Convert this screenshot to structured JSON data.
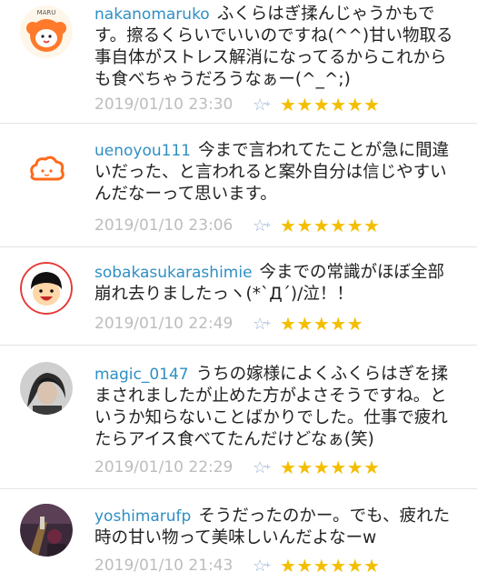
{
  "colors": {
    "username": "#2f8fc4",
    "star": "#f4be00",
    "date": "#bdbdbd"
  },
  "comments": [
    {
      "user": "nakanomaruko",
      "body": "ふくらはぎ揉んじゃうかもです。擦るくらいでいいのですね(^^)甘い物取る事自体がストレス解消になってるからこれからも食べちゃうだろうなぁー(^_^;)",
      "avatar_label": "MARU",
      "date": "2019/01/10 23:30",
      "stars": "★★★★★★",
      "star_count": 6
    },
    {
      "user": "uenoyou111",
      "body": "今まで言われてたことが急に間違いだった、と言われると案外自分は信じやすいんだなーって思います。",
      "date": "2019/01/10 23:06",
      "stars": "★★★★★★",
      "star_count": 6
    },
    {
      "user": "sobakasukarashimie",
      "body": "今までの常識がほぼ全部崩れ去りましたっヽ(*`Д´)/泣！！",
      "date": "2019/01/10 22:49",
      "stars": "★★★★★",
      "star_count": 5
    },
    {
      "user": "magic_0147",
      "body": "うちの嫁様によくふくらはぎを揉まされましたが止めた方がよさそうですね。というか知らないことばかりでした。仕事で疲れたらアイス食べてたんだけどなぁ(笑)",
      "date": "2019/01/10 22:29",
      "stars": "★★★★★★",
      "star_count": 6
    },
    {
      "user": "yoshimarufp",
      "body": "そうだったのかー。でも、疲れた時の甘い物って美味しいんだよなーw",
      "date": "2019/01/10 21:43",
      "stars": "★★★★★★",
      "star_count": 6
    }
  ]
}
